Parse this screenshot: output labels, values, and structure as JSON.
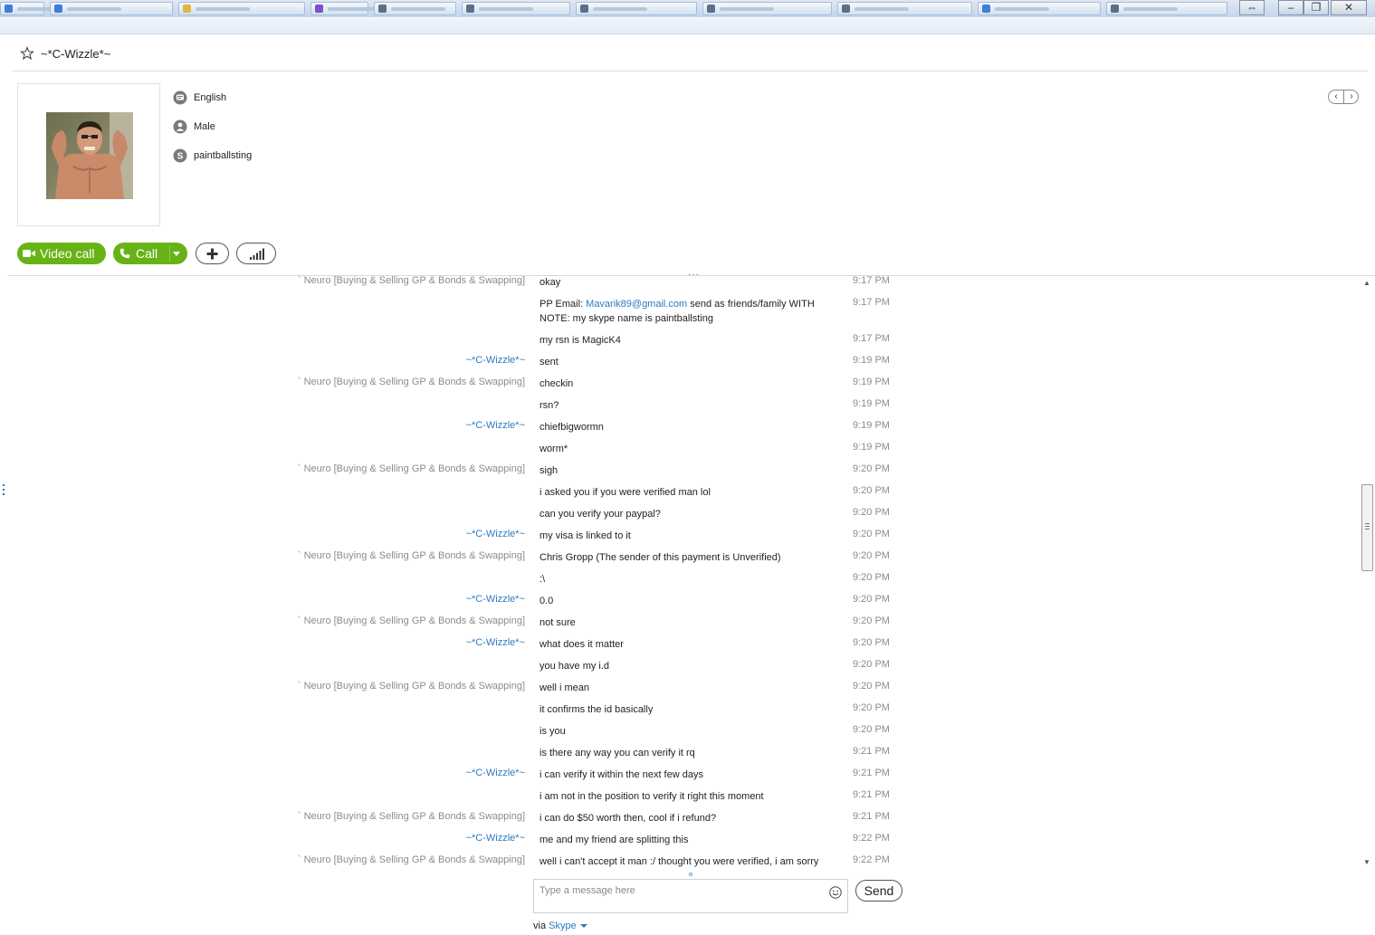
{
  "window": {
    "controls": {
      "resize": "⇔",
      "minimize": "–",
      "restore": "❐",
      "close": "✕"
    },
    "taskbar_items": [
      {
        "icon": "ie-icon",
        "color": "#3d7fd4"
      },
      {
        "icon": "ie-icon",
        "color": "#3d7fd4"
      },
      {
        "icon": "folder-icon",
        "color": "#e1b640"
      },
      {
        "icon": "app-icon",
        "color": "#7a52c7"
      },
      {
        "icon": "app-icon",
        "color": "#5c6f88"
      },
      {
        "icon": "app-icon",
        "color": "#5c6f88"
      },
      {
        "icon": "app-icon",
        "color": "#5c6f88"
      },
      {
        "icon": "app-icon",
        "color": "#5c6f88"
      },
      {
        "icon": "app-icon",
        "color": "#5c6f88"
      },
      {
        "icon": "ie-icon",
        "color": "#3d7fd4"
      },
      {
        "icon": "app-icon",
        "color": "#5c6f88"
      }
    ]
  },
  "header": {
    "contact_name": "~*C-Wizzle*~",
    "favorite_icon": "star-icon"
  },
  "profile": {
    "language": "English",
    "gender": "Male",
    "skype_name": "paintballsting"
  },
  "nav": {
    "prev": "‹",
    "next": "›"
  },
  "actions": {
    "video_call": "Video call",
    "call": "Call",
    "add_icon": "plus-icon",
    "signal_icon": "call-quality-icon"
  },
  "chat": {
    "ellipsis": "...",
    "messages": [
      {
        "sender": "` Neuro [Buying & Selling GP & Bonds & Swapping]",
        "type": "neuro",
        "text": "okay",
        "time": "9:17 PM"
      },
      {
        "sender": "",
        "type": "neuro",
        "text_prefix": "PP Email: ",
        "link": "Mavarik89@gmail.com",
        "text_suffix": "  send as friends/family WITH NOTE: my skype name is paintballsting",
        "time": "9:17 PM"
      },
      {
        "sender": "",
        "type": "neuro",
        "text": "my rsn is MagicK4",
        "time": "9:17 PM"
      },
      {
        "sender": "~*C-Wizzle*~",
        "type": "wiz",
        "text": "sent",
        "time": "9:19 PM"
      },
      {
        "sender": "` Neuro [Buying & Selling GP & Bonds & Swapping]",
        "type": "neuro",
        "text": "checkin",
        "time": "9:19 PM"
      },
      {
        "sender": "",
        "type": "neuro",
        "text": "rsn?",
        "time": "9:19 PM"
      },
      {
        "sender": "~*C-Wizzle*~",
        "type": "wiz",
        "text": "chiefbigwormn",
        "time": "9:19 PM"
      },
      {
        "sender": "",
        "type": "wiz",
        "text": "worm*",
        "time": "9:19 PM"
      },
      {
        "sender": "` Neuro [Buying & Selling GP & Bonds & Swapping]",
        "type": "neuro",
        "text": "sigh",
        "time": "9:20 PM"
      },
      {
        "sender": "",
        "type": "neuro",
        "text": "i asked you if you were verified man lol",
        "time": "9:20 PM"
      },
      {
        "sender": "",
        "type": "neuro",
        "text": "can you verify your paypal?",
        "time": "9:20 PM"
      },
      {
        "sender": "~*C-Wizzle*~",
        "type": "wiz",
        "text": "my visa is linked to it",
        "time": "9:20 PM"
      },
      {
        "sender": "` Neuro [Buying & Selling GP & Bonds & Swapping]",
        "type": "neuro",
        "text": "Chris Gropp (The sender of this payment is Unverified)",
        "time": "9:20 PM"
      },
      {
        "sender": "",
        "type": "neuro",
        "text": ":\\",
        "time": "9:20 PM"
      },
      {
        "sender": "~*C-Wizzle*~",
        "type": "wiz",
        "text": "0.0",
        "time": "9:20 PM"
      },
      {
        "sender": "` Neuro [Buying & Selling GP & Bonds & Swapping]",
        "type": "neuro",
        "text": "not sure",
        "time": "9:20 PM"
      },
      {
        "sender": "~*C-Wizzle*~",
        "type": "wiz",
        "text": "what does it matter",
        "time": "9:20 PM"
      },
      {
        "sender": "",
        "type": "wiz",
        "text": "you have my i.d",
        "time": "9:20 PM"
      },
      {
        "sender": "` Neuro [Buying & Selling GP & Bonds & Swapping]",
        "type": "neuro",
        "text": "well i mean",
        "time": "9:20 PM"
      },
      {
        "sender": "",
        "type": "neuro",
        "text": "it confirms the id basically",
        "time": "9:20 PM"
      },
      {
        "sender": "",
        "type": "neuro",
        "text": "is you",
        "time": "9:20 PM"
      },
      {
        "sender": "",
        "type": "neuro",
        "text": "is there any way you can verify it rq",
        "time": "9:21 PM"
      },
      {
        "sender": "~*C-Wizzle*~",
        "type": "wiz",
        "text": "i can verify it within the next few days",
        "time": "9:21 PM"
      },
      {
        "sender": "",
        "type": "wiz",
        "text": "i am not in the position to verify it right this moment",
        "time": "9:21 PM"
      },
      {
        "sender": "` Neuro [Buying & Selling GP & Bonds & Swapping]",
        "type": "neuro",
        "text": "i can do $50 worth then, cool if i refund?",
        "time": "9:21 PM"
      },
      {
        "sender": "~*C-Wizzle*~",
        "type": "wiz",
        "text": "me and my friend are splitting this",
        "time": "9:22 PM"
      },
      {
        "sender": "` Neuro [Buying & Selling GP & Bonds & Swapping]",
        "type": "neuro",
        "text": "well i can't accept it man :/ thought you were verified, i am sorry",
        "time": "9:22 PM"
      }
    ]
  },
  "compose": {
    "placeholder": "Type a message here",
    "value": "",
    "emoticon_icon": "smiley-icon",
    "send_label": "Send",
    "via_label": "via ",
    "via_service": "Skype"
  },
  "colors": {
    "accent_green": "#67b316",
    "link_blue": "#2b7bbf",
    "muted_gray": "#8c8c8c"
  }
}
